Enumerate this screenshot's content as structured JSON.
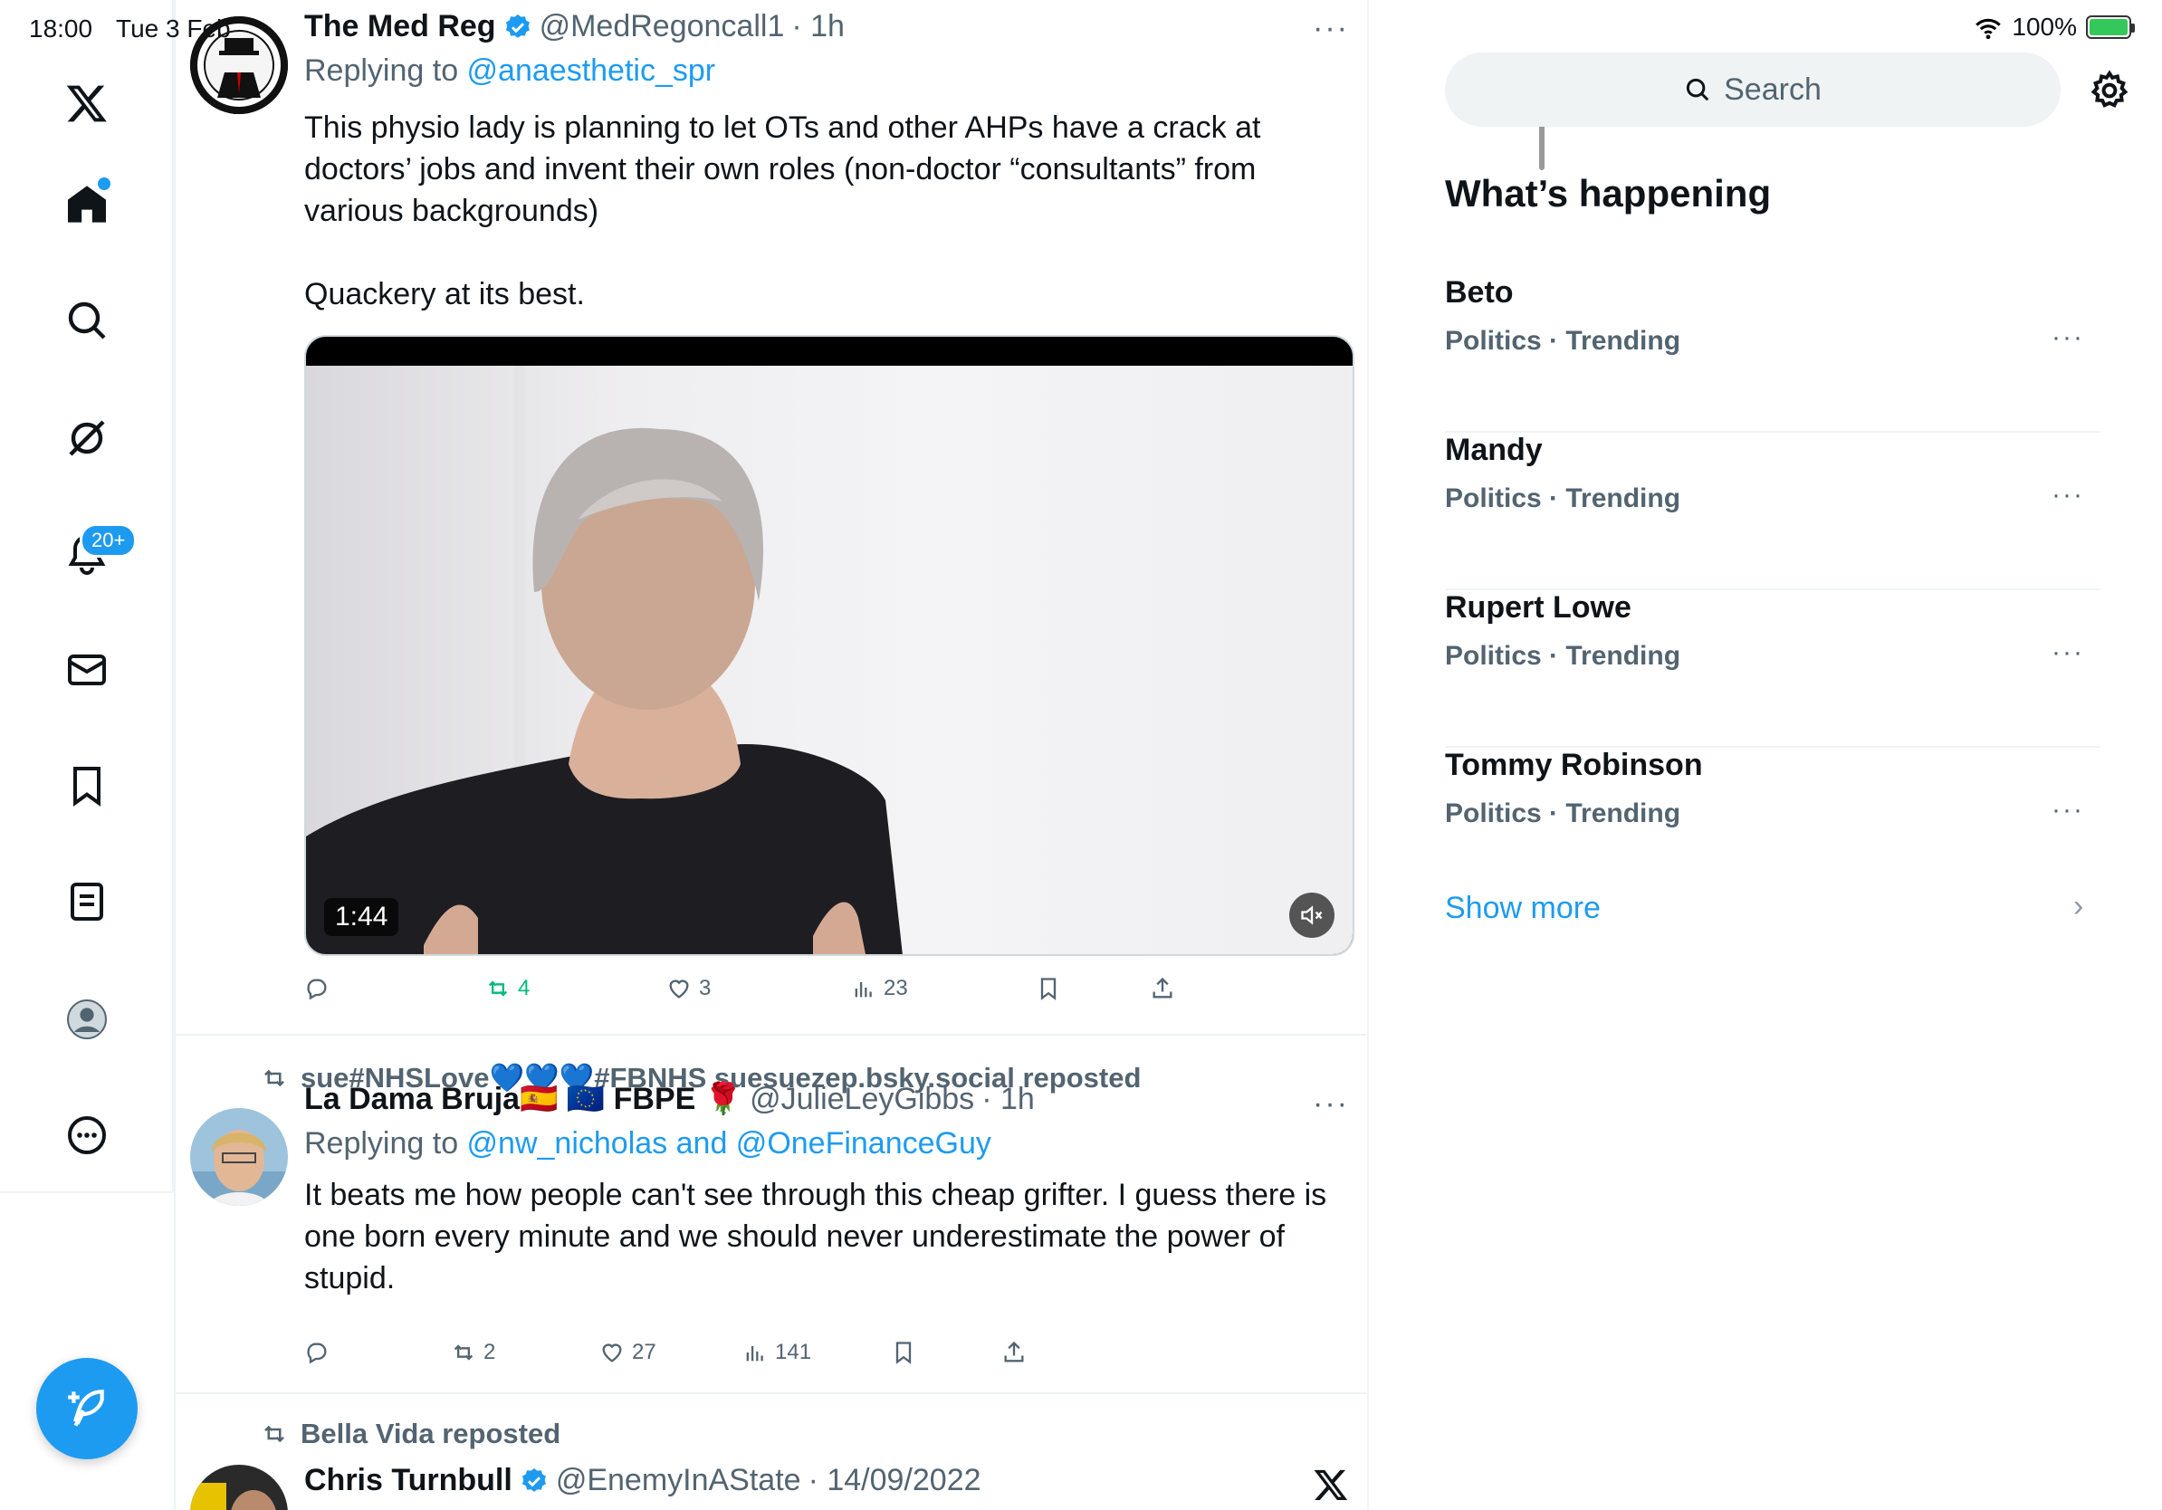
{
  "status_bar": {
    "time": "18:00",
    "date": "Tue 3 Feb",
    "battery": "100%"
  },
  "nav": {
    "notifications_badge": "20+",
    "items": [
      "x-logo",
      "home",
      "explore",
      "grok",
      "notifications",
      "messages",
      "bookmarks",
      "lists",
      "profile",
      "more"
    ]
  },
  "tweets": [
    {
      "name": "The Med Reg",
      "handle": "@MedRegoncall1",
      "time": "· 1h",
      "replying_prefix": "Replying to ",
      "replying_to": "@anaesthetic_spr",
      "text": "This physio lady is planning to let OTs and other AHPs have a crack at doctors’ jobs and invent their own roles (non-doctor “consultants” from various backgrounds)\n\nQuackery at its best.",
      "video_duration": "1:44",
      "reposts": "4",
      "likes": "3",
      "views": "23"
    },
    {
      "reposted_by": "sue#NHSLove💙💙💙#FBNHS suesuezep.bsky.social reposted",
      "name": "La Dama Bruja🇪🇸 🇪🇺 FBPE 🌹",
      "handle": "@JulieLeyGibbs",
      "time": "· 1h",
      "replying_prefix": "Replying to ",
      "replying_to": "@nw_nicholas and @OneFinanceGuy",
      "text": "It beats me how people can't see through this cheap grifter. I guess there is one born every minute and we should never underestimate the power of stupid.",
      "reposts": "2",
      "likes": "27",
      "views": "141"
    },
    {
      "reposted_by": "Bella Vida reposted",
      "name": "Chris Turnbull",
      "handle": "@EnemyInAState",
      "time": "· 14/09/2022"
    }
  ],
  "sidebar": {
    "search_placeholder": "Search",
    "title": "What’s happening",
    "trends": [
      {
        "name": "Beto",
        "category": "Politics · Trending"
      },
      {
        "name": "Mandy",
        "category": "Politics · Trending"
      },
      {
        "name": "Rupert Lowe",
        "category": "Politics · Trending"
      },
      {
        "name": "Tommy Robinson",
        "category": "Politics · Trending"
      }
    ],
    "show_more": "Show more"
  },
  "colors": {
    "accent": "#1d9bf0",
    "repost_green": "#00ba7c",
    "muted": "#536471"
  }
}
